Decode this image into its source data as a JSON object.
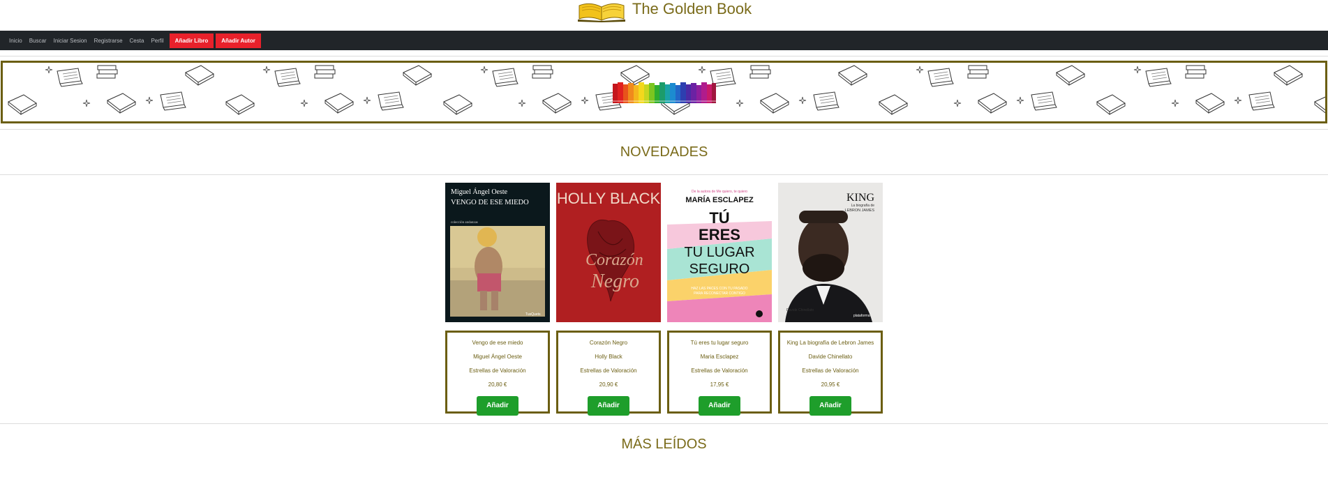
{
  "header": {
    "title": "The Golden Book",
    "logo_icon": "open-book-icon"
  },
  "nav": {
    "links": [
      "Inicio",
      "Buscar",
      "Iniciar Sesion",
      "Registrarse",
      "Cesta",
      "Perfil"
    ],
    "buttons": [
      "Añadir Libro",
      "Añadir Autor"
    ]
  },
  "sections": {
    "novedades": "NOVEDADES",
    "mas_leidos": "MÁS LEÍDOS"
  },
  "books": [
    {
      "title": "Vengo de ese miedo",
      "author": "Miguel Ángel Oeste",
      "rating": "Estrellas de Valoración",
      "price": "20,80 €",
      "add_label": "Añadir",
      "cover": {
        "author_line": "Miguel Ángel Oeste",
        "title_line": "VENGO DE ESE MIEDO",
        "collection": "colección andanzas",
        "publisher": "TusQuets"
      }
    },
    {
      "title": "Corazón Negro",
      "author": "Holly Black",
      "rating": "Estrellas de Valoración",
      "price": "20,90 €",
      "add_label": "Añadir",
      "cover": {
        "author_line": "HOLLY BLACK",
        "script_line_1": "Corazón",
        "script_line_2": "Negro"
      }
    },
    {
      "title": "Tú eres tu lugar seguro",
      "author": "Maria Esclapez",
      "rating": "Estrellas de Valoración",
      "price": "17,95 €",
      "add_label": "Añadir",
      "cover": {
        "top_line": "De la autora de Me quiero, te quiero",
        "author_line": "MARÍA ESCLAPEZ",
        "title_1": "TÚ",
        "title_2": "ERES",
        "title_3": "TU LUGAR",
        "title_4": "SEGURO",
        "subtitle_1": "HAZ LAS PACES CON TU PASADO",
        "subtitle_2": "PARA RECONECTAR CONTIGO"
      }
    },
    {
      "title": "King La biografía de Lebron James",
      "author": "Davide Chinellato",
      "rating": "Estrellas de Valoración",
      "price": "20,95 €",
      "add_label": "Añadir",
      "cover": {
        "title_line": "KING",
        "sub_1": "La biografía de",
        "sub_2": "LEBRON JAMES",
        "author_line": "Davide Chinellato",
        "publisher": "plataforma"
      }
    }
  ],
  "colors": {
    "gold": "#6b5e12",
    "nav_bg": "#212529",
    "red": "#e8212b",
    "green": "#1e9e2b"
  }
}
